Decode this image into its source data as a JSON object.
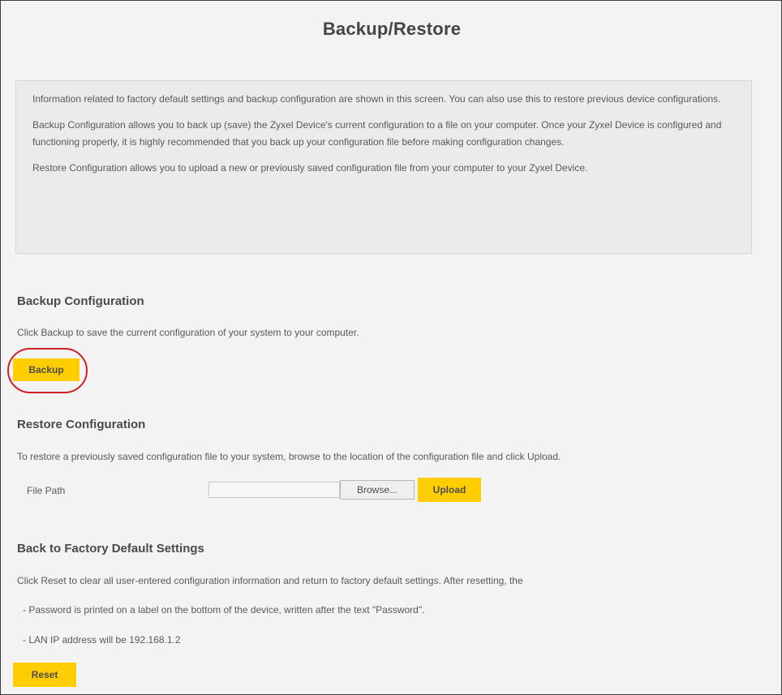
{
  "page": {
    "title": "Backup/Restore"
  },
  "info": {
    "p1": "Information related to factory default settings and backup configuration are shown in this screen. You can also use this to restore previous device configurations.",
    "p2": "Backup Configuration allows you to back up (save) the Zyxel Device's current configuration to a file on your computer. Once your Zyxel Device is configured and functioning properly, it is highly recommended that you back up your configuration file before making configuration changes.",
    "p3": "Restore Configuration allows you to upload a new or previously saved configuration file from your computer to your Zyxel Device."
  },
  "backup": {
    "title": "Backup Configuration",
    "description": "Click Backup to save the current configuration of your system to your computer.",
    "button_label": "Backup"
  },
  "restore": {
    "title": "Restore Configuration",
    "description": "To restore a previously saved configuration file to your system, browse to the location of the configuration file and click Upload.",
    "file_path_label": "File Path",
    "file_path_value": "",
    "browse_label": "Browse...",
    "upload_label": "Upload"
  },
  "factory": {
    "title": "Back to Factory Default Settings",
    "description": "Click Reset to clear all user-entered configuration information and return to factory default settings. After resetting, the",
    "bullet1": "- Password is printed on a label on the bottom of the device, written after the text \"Password\".",
    "bullet2": "- LAN IP address will be 192.168.1.2",
    "reset_label": "Reset"
  },
  "colors": {
    "accent": "#ffcd00",
    "highlight_ring": "#d01e24"
  }
}
